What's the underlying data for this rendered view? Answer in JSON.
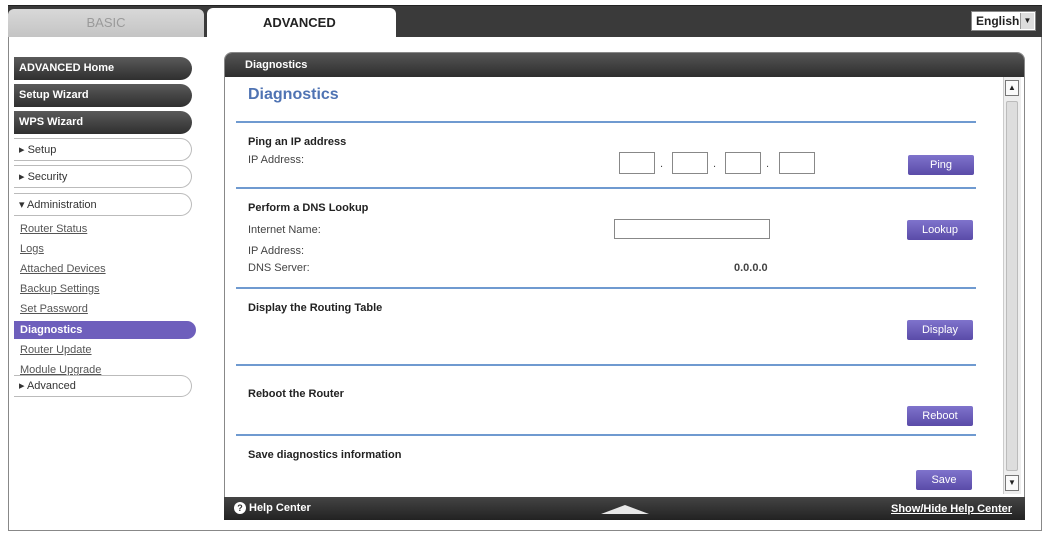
{
  "tabs": {
    "basic": "BASIC",
    "advanced": "ADVANCED"
  },
  "language": {
    "selected": "English"
  },
  "sidebar": {
    "items": [
      {
        "label": "ADVANCED Home"
      },
      {
        "label": "Setup Wizard"
      },
      {
        "label": "WPS Wizard"
      },
      {
        "label": "▸ Setup"
      },
      {
        "label": "▸ Security"
      },
      {
        "label": "▾ Administration"
      }
    ],
    "admin_sub": [
      {
        "label": "Router Status"
      },
      {
        "label": "Logs"
      },
      {
        "label": "Attached Devices"
      },
      {
        "label": "Backup Settings"
      },
      {
        "label": "Set Password"
      },
      {
        "label": "Diagnostics"
      },
      {
        "label": "Router Update"
      },
      {
        "label": "Module Upgrade"
      }
    ],
    "advanced": {
      "label": "▸ Advanced"
    }
  },
  "panel": {
    "header": "Diagnostics",
    "title": "Diagnostics",
    "ping": {
      "title": "Ping an IP address",
      "ip_label": "IP Address:",
      "dot": ".",
      "button": "Ping"
    },
    "dns": {
      "title": "Perform a DNS Lookup",
      "internet_name_label": "Internet Name:",
      "ip_label": "IP Address:",
      "dns_server_label": "DNS Server:",
      "dns_server_value": "0.0.0.0",
      "button": "Lookup"
    },
    "routing": {
      "title": "Display the Routing Table",
      "button": "Display"
    },
    "reboot": {
      "title": "Reboot the Router",
      "button": "Reboot"
    },
    "save": {
      "title": "Save diagnostics information",
      "button": "Save"
    }
  },
  "footer": {
    "help": "Help Center",
    "show_hide": "Show/Hide Help Center"
  }
}
